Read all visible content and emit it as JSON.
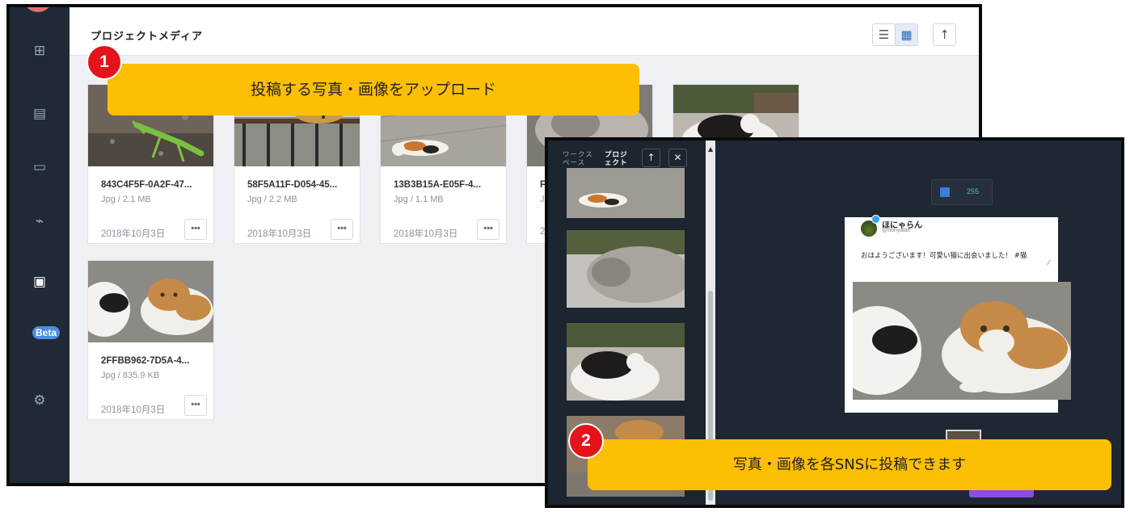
{
  "main": {
    "title": "プロジェクトメディア",
    "sidebar_beta": "Beta",
    "header_buttons": {
      "list": "☰",
      "grid": "▦",
      "upload": "↑"
    },
    "cards": [
      {
        "name": "843C4F5F-0A2F-47...",
        "meta": "Jpg / 2.1 MB",
        "date": "2018年10月3日",
        "more": "•••",
        "art": "mantis"
      },
      {
        "name": "58F5A11F-D054-45...",
        "meta": "Jpg / 2.2 MB",
        "date": "2018年10月3日",
        "more": "•••",
        "art": "leopard-cat"
      },
      {
        "name": "13B3B15A-E05F-4...",
        "meta": "Jpg / 1.1 MB",
        "date": "2018年10月3日",
        "more": "•••",
        "art": "calico-lying"
      },
      {
        "name": "F",
        "meta": "J",
        "date": "2",
        "more": "",
        "art": "grey-cat"
      },
      {
        "name": "",
        "meta": "",
        "date": "",
        "more": "",
        "art": "bw-cat-temple"
      },
      {
        "name": "2FFBB962-7D5A-4...",
        "meta": "Jpg / 835.9 KB",
        "date": "2018年10月3日",
        "more": "•••",
        "art": "two-cats"
      }
    ]
  },
  "callouts": {
    "one": {
      "number": "1",
      "text": "投稿する写真・画像をアップロード"
    },
    "two": {
      "number": "2",
      "text": "写真・画像を各SNSに投稿できます"
    }
  },
  "publish": {
    "tab_workspace": "ワークス\nペース",
    "tab_project": "プロジ\nェクト",
    "up_label": "↑",
    "close_label": "✕",
    "scroll_up": "▲",
    "media_count": "255",
    "post": {
      "username": "ほにゃらん",
      "handle": "@honyalan",
      "text": "おはようございます！可愛い猫に出会いました！ #猫",
      "resize": "⁄⁄"
    }
  },
  "colors": {
    "sidebar": "#1f2a36",
    "callout": "#fcbf04",
    "badge": "#e3141b",
    "beta": "#4a8fe0",
    "count": "#4fc3a1"
  }
}
